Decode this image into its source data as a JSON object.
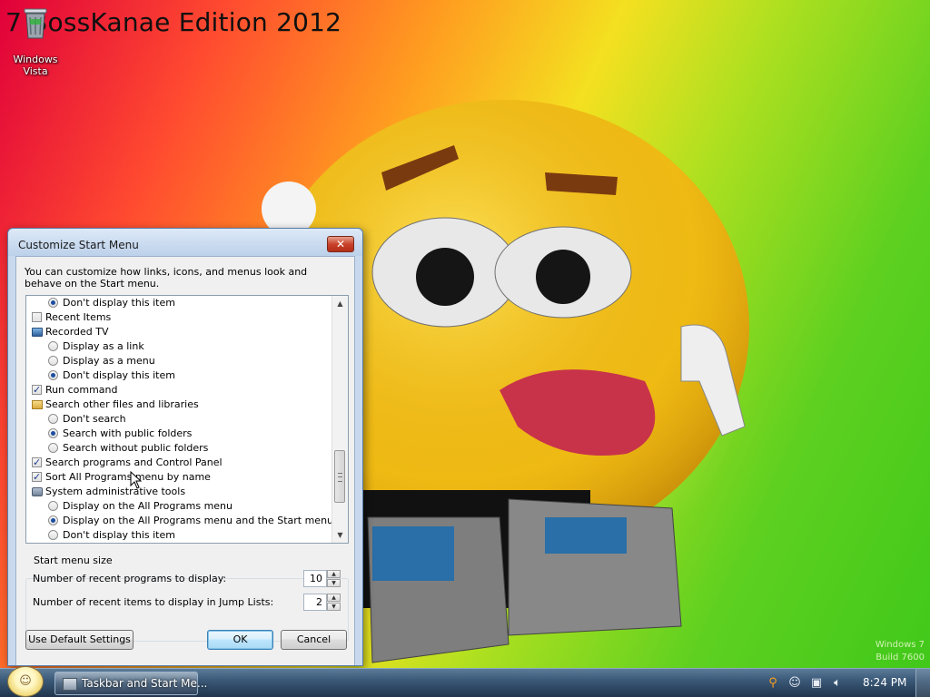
{
  "desktop": {
    "edition_title": "7 BossKanae Edition 2012",
    "icon_label_line1": "Windows",
    "icon_label_line2": "Vista",
    "watermark_line1": "Windows 7",
    "watermark_line2": "Build 7600"
  },
  "dialog": {
    "title": "Customize Start Menu",
    "close_glyph": "✕",
    "intro": "You can customize how links, icons, and menus look and behave on the Start menu.",
    "items": [
      {
        "label": "Don't display this item",
        "type": "radio",
        "checked": true,
        "level": 1
      },
      {
        "label": "Recent Items",
        "type": "checkbox",
        "checked": false,
        "level": 0
      },
      {
        "label": "Recorded TV",
        "type": "tv-icon",
        "level": 0
      },
      {
        "label": "Display as a link",
        "type": "radio",
        "checked": false,
        "level": 1
      },
      {
        "label": "Display as a menu",
        "type": "radio",
        "checked": false,
        "level": 1
      },
      {
        "label": "Don't display this item",
        "type": "radio",
        "checked": true,
        "level": 1
      },
      {
        "label": "Run command",
        "type": "checkbox",
        "checked": true,
        "level": 0
      },
      {
        "label": "Search other files and libraries",
        "type": "folder-icon",
        "level": 0
      },
      {
        "label": "Don't search",
        "type": "radio",
        "checked": false,
        "level": 1
      },
      {
        "label": "Search with public folders",
        "type": "radio",
        "checked": true,
        "level": 1
      },
      {
        "label": "Search without public folders",
        "type": "radio",
        "checked": false,
        "level": 1
      },
      {
        "label": "Search programs and Control Panel",
        "type": "checkbox",
        "checked": true,
        "level": 0
      },
      {
        "label": "Sort All Programs menu by name",
        "type": "checkbox",
        "checked": true,
        "level": 0
      },
      {
        "label": "System administrative tools",
        "type": "tools-icon",
        "level": 0
      },
      {
        "label": "Display on the All Programs menu",
        "type": "radio",
        "checked": false,
        "level": 1
      },
      {
        "label": "Display on the All Programs menu and the Start menu",
        "type": "radio",
        "checked": true,
        "level": 1
      },
      {
        "label": "Don't display this item",
        "type": "radio",
        "checked": false,
        "level": 1
      }
    ],
    "size_group_label": "Start menu size",
    "recent_programs_label": "Number of recent programs to display:",
    "recent_programs_value": "10",
    "recent_items_label": "Number of recent items to display in Jump Lists:",
    "recent_items_value": "2",
    "default_button": "Use Default Settings",
    "ok_button": "OK",
    "cancel_button": "Cancel"
  },
  "taskbar": {
    "task_label": "Taskbar and Start Me...",
    "clock": "8:24 PM"
  }
}
